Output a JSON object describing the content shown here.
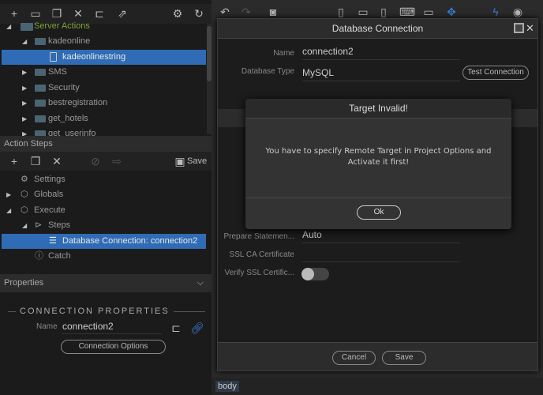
{
  "left_toolbar": {
    "icons": [
      "plus-icon",
      "folder-icon",
      "copy-icon",
      "close-icon",
      "folder-open-icon",
      "export-icon",
      "gear-icon",
      "refresh-icon"
    ]
  },
  "tree": {
    "root": "Server Actions",
    "items": [
      {
        "label": "kadeonline",
        "level": 1,
        "expanded": true
      },
      {
        "label": "kadeonlinestring",
        "level": 2,
        "selected": true
      },
      {
        "label": "SMS",
        "level": 1
      },
      {
        "label": "Security",
        "level": 1
      },
      {
        "label": "bestregistration",
        "level": 1
      },
      {
        "label": "get_hotels",
        "level": 1
      },
      {
        "label": "get_userinfo",
        "level": 1
      }
    ]
  },
  "action_steps": {
    "title": "Action Steps",
    "save_label": "Save",
    "items": [
      {
        "label": "Settings"
      },
      {
        "label": "Globals"
      },
      {
        "label": "Execute"
      },
      {
        "label": "Steps"
      },
      {
        "label": "Database Connection: connection2"
      },
      {
        "label": "Catch"
      }
    ]
  },
  "properties": {
    "title": "Properties",
    "section": "CONNECTION PROPERTIES",
    "name_label": "Name",
    "name_value": "connection2",
    "options_button": "Connection Options"
  },
  "dialog": {
    "title": "Database Connection",
    "name_label": "Name",
    "name_value": "connection2",
    "dbtype_label": "Database Type",
    "dbtype_value": "MySQL",
    "test_button": "Test Connection",
    "prepare_label": "Prepare Statemen...",
    "prepare_value": "Auto",
    "sslca_label": "SSL CA Certificate",
    "sslca_value": "",
    "verify_label": "Verify SSL Certific...",
    "verify_on": false,
    "cancel": "Cancel",
    "save": "Save"
  },
  "alert": {
    "title": "Target Invalid!",
    "message": "You have to specify Remote Target in Project Options and Activate it first!",
    "ok": "Ok"
  },
  "status": {
    "tag": "body"
  },
  "colors": {
    "selection": "#2f6cb5",
    "accent": "#3a7bd5",
    "root_green": "#7fa63a"
  }
}
